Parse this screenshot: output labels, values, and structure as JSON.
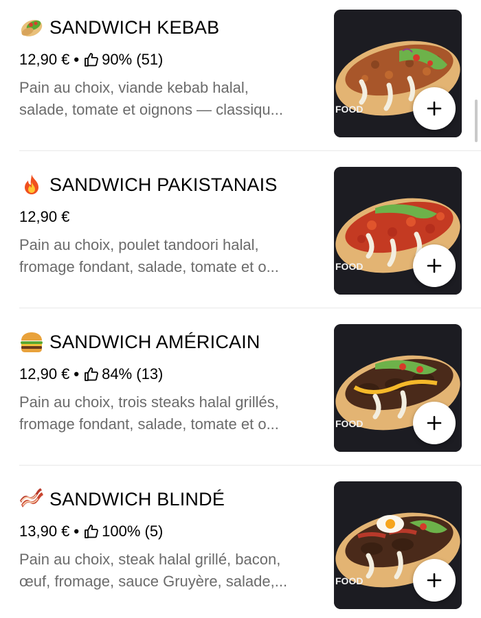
{
  "items": [
    {
      "emoji": "burrito-icon",
      "title": "SANDWICH KEBAB",
      "price": "12,90 €",
      "separator": "•",
      "rating": "90% (51)",
      "desc_line1": "Pain au choix, viande kebab halal,",
      "desc_line2": "salade, tomate et oignons — classiqu...",
      "add_label": "+"
    },
    {
      "emoji": "fire-icon",
      "title": "SANDWICH PAKISTANAIS",
      "price": "12,90 €",
      "desc_line1": "Pain au choix, poulet tandoori halal,",
      "desc_line2": "fromage fondant, salade, tomate et o...",
      "add_label": "+"
    },
    {
      "emoji": "burger-icon",
      "title": "SANDWICH AMÉRICAIN",
      "price": "12,90 €",
      "separator": "•",
      "rating": "84% (13)",
      "desc_line1": "Pain au choix, trois steaks halal grillés,",
      "desc_line2": "fromage fondant, salade, tomate et o...",
      "add_label": "+"
    },
    {
      "emoji": "bacon-icon",
      "title": "SANDWICH BLINDÉ",
      "price": "13,90 €",
      "separator": "•",
      "rating": "100% (5)",
      "desc_line1": "Pain au choix, steak halal grillé, bacon,",
      "desc_line2": "œuf, fromage, sauce Gruyère, salade,...",
      "add_label": "+"
    }
  ],
  "photo_text": "FOOD",
  "colors": {
    "text": "#000000",
    "description": "#6b6b6b",
    "divider": "#e8e8e8",
    "photo_background": "#1b1b1f"
  }
}
